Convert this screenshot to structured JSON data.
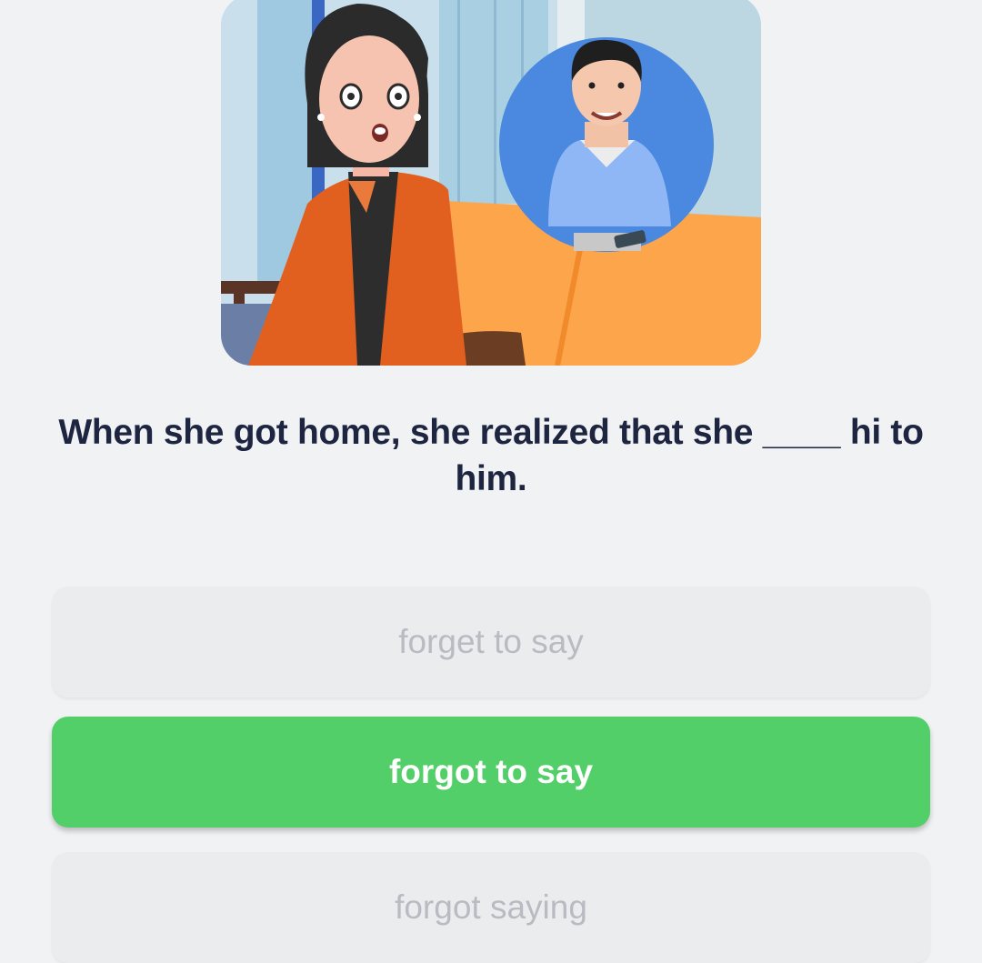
{
  "question": {
    "text": "When she got home, she realized that she ____ hi to him."
  },
  "options": [
    {
      "label": "forget to say",
      "state": "disabled"
    },
    {
      "label": "forgot to say",
      "state": "selected"
    },
    {
      "label": "forgot saying",
      "state": "disabled"
    }
  ],
  "colors": {
    "background": "#f1f2f4",
    "selected": "#52cf69",
    "question_text": "#1d2540",
    "disabled_text": "#b8bbc2"
  },
  "icons": [
    "woman-illustration",
    "man-avatar-illustration"
  ]
}
